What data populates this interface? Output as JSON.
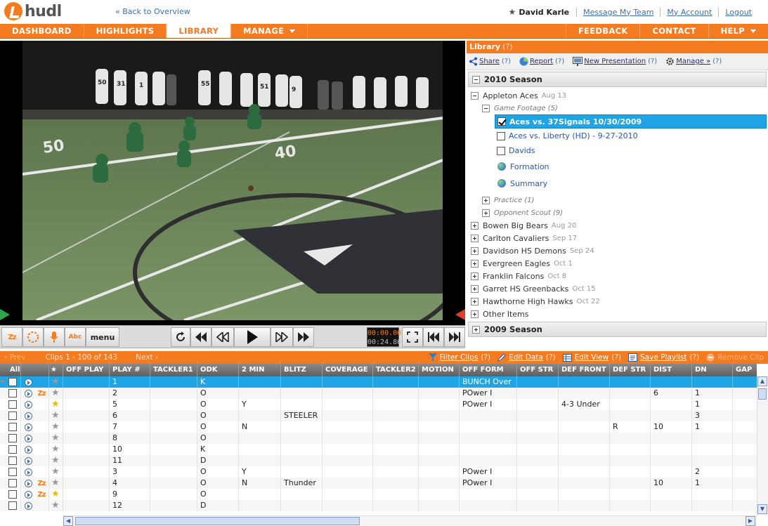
{
  "brand": {
    "name": "hudl",
    "accent": "#f47b20"
  },
  "topbar": {
    "back_link": "« Back to Overview",
    "user": "David Karle",
    "links": [
      "Message My Team",
      "My Account",
      "Logout"
    ]
  },
  "nav": {
    "left": [
      {
        "label": "DASHBOARD"
      },
      {
        "label": "HIGHLIGHTS"
      },
      {
        "label": "LIBRARY",
        "active": true
      },
      {
        "label": "MANAGE",
        "dropdown": true
      }
    ],
    "right": [
      {
        "label": "FEEDBACK"
      },
      {
        "label": "CONTACT"
      },
      {
        "label": "HELP",
        "dropdown": true
      }
    ]
  },
  "player": {
    "time_current": "00:00.00",
    "time_total": "00:24.86",
    "menu_label": "menu",
    "abc_label": "Abc",
    "yard_labels": [
      "50",
      "40"
    ],
    "jerseys": [
      "50",
      "31",
      "1",
      "55",
      "51",
      "9"
    ]
  },
  "library": {
    "title": "Library",
    "help": "(?)",
    "toolbar": [
      {
        "label": "Share",
        "help": "(?)"
      },
      {
        "label": "Report",
        "help": "(?)"
      },
      {
        "label": "New Presentation",
        "help": "(?)"
      },
      {
        "label": "Manage »",
        "help": "(?)"
      }
    ],
    "season_2010": "2010 Season",
    "team_open": {
      "name": "Appleton Aces",
      "date": "Aug 13"
    },
    "game_footage": "Game Footage (5)",
    "clips": [
      {
        "label": "Aces vs. 37Signals 10/30/2009",
        "checked": true,
        "selected": true
      },
      {
        "label": "Aces vs. Liberty (HD) - 9-27-2010",
        "checked": false
      },
      {
        "label": "Davids",
        "checked": false
      }
    ],
    "reports": [
      "Formation",
      "Summary"
    ],
    "subfolders": [
      "Practice (1)",
      "Opponent Scout (9)"
    ],
    "teams": [
      {
        "name": "Bowen Big Bears",
        "date": "Aug 20"
      },
      {
        "name": "Carlton Cavaliers",
        "date": "Sep 17"
      },
      {
        "name": "Davidson HS Demons",
        "date": "Sep 24"
      },
      {
        "name": "Evergreen Eagles",
        "date": "Oct 1"
      },
      {
        "name": "Franklin Falcons",
        "date": "Oct 8"
      },
      {
        "name": "Garret HS Greenbacks",
        "date": "Oct 15"
      },
      {
        "name": "Hawthorne High Hawks",
        "date": "Oct 22"
      },
      {
        "name": "Other Items",
        "date": ""
      }
    ],
    "season_2009": "2009 Season"
  },
  "clipbar": {
    "prev": "‹ Prev",
    "count": "Clips 1 - 100 of 143",
    "next": "Next ›",
    "actions": [
      {
        "label": "Filter Clips",
        "help": "(?)"
      },
      {
        "label": "Edit Data",
        "help": "(?)"
      },
      {
        "label": "Edit View",
        "help": "(?)"
      },
      {
        "label": "Save Playlist",
        "help": "(?)"
      }
    ],
    "remove": "Remove Clip"
  },
  "grid": {
    "all_label": "All",
    "columns": [
      "OFF PLAY",
      "PLAY #",
      "TACKLER1",
      "ODK",
      "2 MIN",
      "BLITZ",
      "COVERAGE",
      "TACKLER2",
      "MOTION",
      "OFF FORM",
      "OFF STR",
      "DEF FRONT",
      "DEF STR",
      "DIST",
      "DN",
      "GAP"
    ],
    "rows": [
      {
        "cells": [
          "",
          "1",
          "",
          "K",
          "",
          "",
          "",
          "",
          "",
          "BUNCH Over",
          "",
          "",
          "",
          "",
          "",
          ""
        ],
        "zz": false,
        "starred": false,
        "current": true
      },
      {
        "cells": [
          "",
          "2",
          "",
          "O",
          "",
          "",
          "",
          "",
          "",
          "POwer I",
          "",
          "",
          "",
          "6",
          "1",
          ""
        ],
        "zz": true,
        "starred": false
      },
      {
        "cells": [
          "",
          "5",
          "",
          "O",
          "Y",
          "",
          "",
          "",
          "",
          "POwer I",
          "",
          "4-3 Under",
          "",
          "",
          "1",
          ""
        ],
        "zz": false,
        "starred": true
      },
      {
        "cells": [
          "",
          "6",
          "",
          "O",
          "",
          "STEELER",
          "",
          "",
          "",
          "",
          "",
          "",
          "",
          "",
          "3",
          ""
        ],
        "zz": false,
        "starred": false
      },
      {
        "cells": [
          "",
          "7",
          "",
          "O",
          "N",
          "",
          "",
          "",
          "",
          "",
          "",
          "",
          "R",
          "10",
          "1",
          ""
        ],
        "zz": false,
        "starred": false
      },
      {
        "cells": [
          "",
          "8",
          "",
          "O",
          "",
          "",
          "",
          "",
          "",
          "",
          "",
          "",
          "",
          "",
          "",
          ""
        ],
        "zz": false,
        "starred": false
      },
      {
        "cells": [
          "",
          "10",
          "",
          "K",
          "",
          "",
          "",
          "",
          "",
          "",
          "",
          "",
          "",
          "",
          "",
          ""
        ],
        "zz": false,
        "starred": false
      },
      {
        "cells": [
          "",
          "11",
          "",
          "D",
          "",
          "",
          "",
          "",
          "",
          "",
          "",
          "",
          "",
          "",
          "",
          ""
        ],
        "zz": false,
        "starred": false
      },
      {
        "cells": [
          "",
          "3",
          "",
          "O",
          "Y",
          "",
          "",
          "",
          "",
          "POwer I",
          "",
          "",
          "",
          "",
          "2",
          ""
        ],
        "zz": false,
        "starred": false
      },
      {
        "cells": [
          "",
          "4",
          "",
          "O",
          "N",
          "Thunder",
          "",
          "",
          "",
          "POwer I",
          "",
          "",
          "",
          "10",
          "1",
          ""
        ],
        "zz": true,
        "starred": false
      },
      {
        "cells": [
          "",
          "9",
          "",
          "O",
          "",
          "",
          "",
          "",
          "",
          "",
          "",
          "",
          "",
          "",
          "",
          ""
        ],
        "zz": true,
        "starred": true
      },
      {
        "cells": [
          "",
          "12",
          "",
          "D",
          "",
          "",
          "",
          "",
          "",
          "",
          "",
          "",
          "",
          "",
          "",
          ""
        ],
        "zz": false,
        "starred": false
      }
    ]
  }
}
